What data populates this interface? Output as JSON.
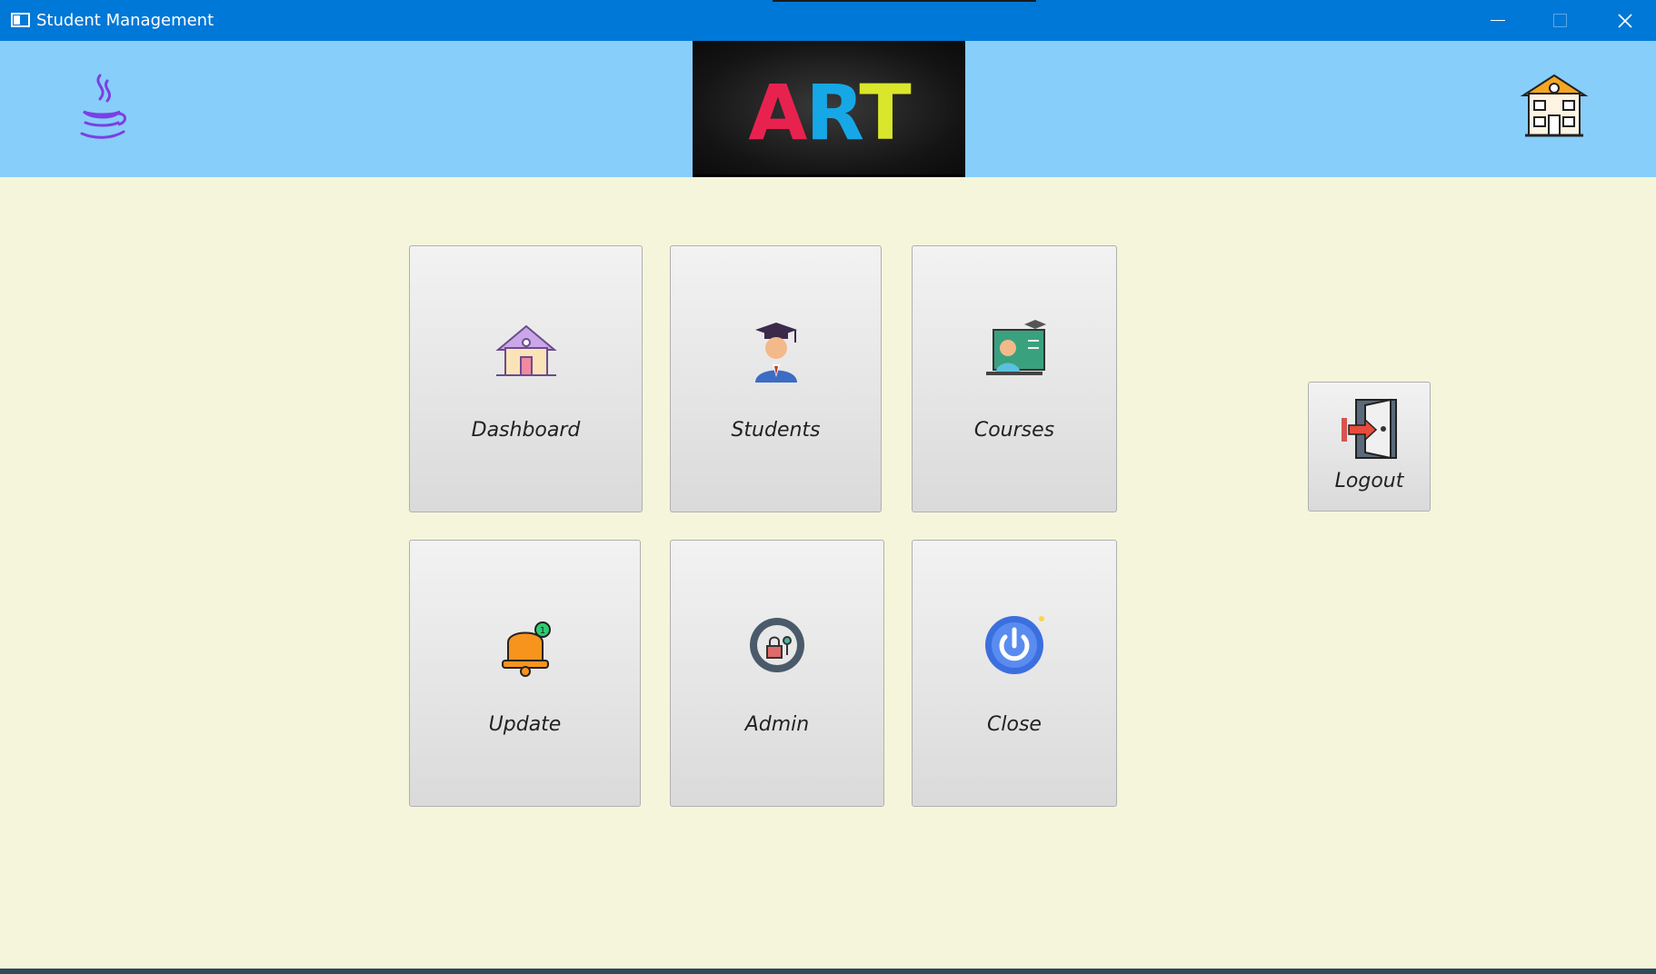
{
  "window": {
    "title": "Student Management",
    "controls": {
      "minimize_icon": "minimize-icon",
      "maximize_icon": "maximize-icon",
      "close_icon": "close-icon"
    }
  },
  "header": {
    "left_logo": "java-logo",
    "banner_text": [
      "A",
      "R",
      "T"
    ],
    "banner_colors": [
      "#e8224f",
      "#16a8e6",
      "#d9e62b"
    ],
    "right_logo": "school-building-icon"
  },
  "menu": {
    "dashboard": {
      "label": "Dashboard",
      "icon": "house-icon"
    },
    "students": {
      "label": "Students",
      "icon": "graduate-student-icon"
    },
    "courses": {
      "label": "Courses",
      "icon": "teacher-board-icon"
    },
    "update": {
      "label": "Update",
      "icon": "notification-bell-icon"
    },
    "admin": {
      "label": "Admin",
      "icon": "gear-lock-icon"
    },
    "close": {
      "label": "Close",
      "icon": "power-icon"
    }
  },
  "logout": {
    "label": "Logout",
    "icon": "exit-door-icon"
  },
  "colors": {
    "titlebar": "#0078d7",
    "header": "#87cefa",
    "background": "#f5f5dc"
  }
}
